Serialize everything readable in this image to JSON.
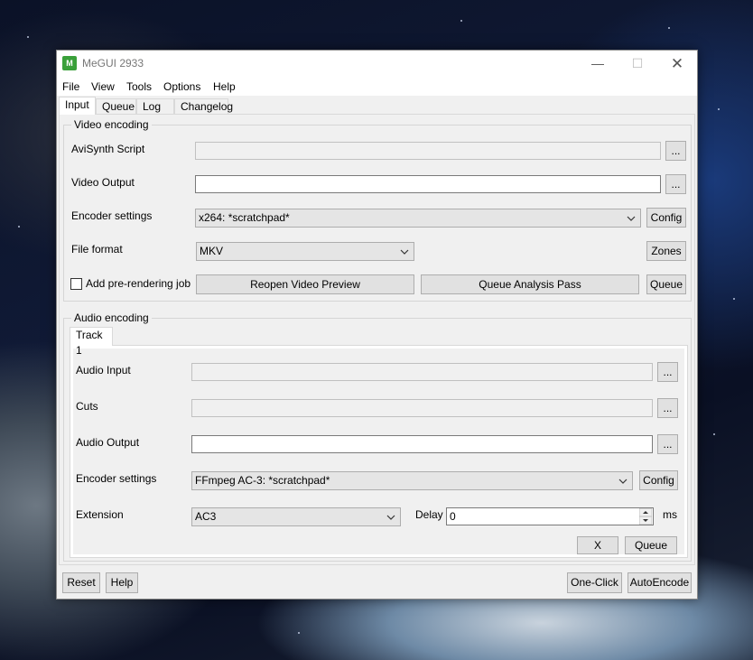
{
  "window": {
    "app_icon_text": "M",
    "title": "MeGUI 2933",
    "min_glyph": "—",
    "max_glyph": "☐",
    "close_glyph": "✕"
  },
  "menu": [
    "File",
    "View",
    "Tools",
    "Options",
    "Help"
  ],
  "tabs": [
    "Input",
    "Queue",
    "Log",
    "Changelog"
  ],
  "video": {
    "group_title": "Video encoding",
    "avisynth_label": "AviSynth Script",
    "avisynth_value": "",
    "output_label": "Video Output",
    "output_value": "",
    "encoder_label": "Encoder settings",
    "encoder_value": "x264: *scratchpad*",
    "format_label": "File format",
    "format_value": "MKV",
    "browse": "...",
    "config": "Config",
    "zones": "Zones",
    "prerender_label": "Add pre-rendering job",
    "reopen_preview": "Reopen Video Preview",
    "queue_analysis": "Queue Analysis Pass",
    "queue": "Queue"
  },
  "audio": {
    "group_title": "Audio encoding",
    "track_tab": "Track 1",
    "input_label": "Audio Input",
    "input_value": "",
    "cuts_label": "Cuts",
    "cuts_value": "",
    "output_label": "Audio Output",
    "output_value": "",
    "encoder_label": "Encoder settings",
    "encoder_value": "FFmpeg AC-3: *scratchpad*",
    "extension_label": "Extension",
    "extension_value": "AC3",
    "delay_label": "Delay",
    "delay_value": "0",
    "delay_unit": "ms",
    "browse": "...",
    "config": "Config",
    "x_button": "X",
    "queue": "Queue"
  },
  "footer": {
    "reset": "Reset",
    "help": "Help",
    "one_click": "One-Click",
    "auto_encode": "AutoEncode"
  }
}
